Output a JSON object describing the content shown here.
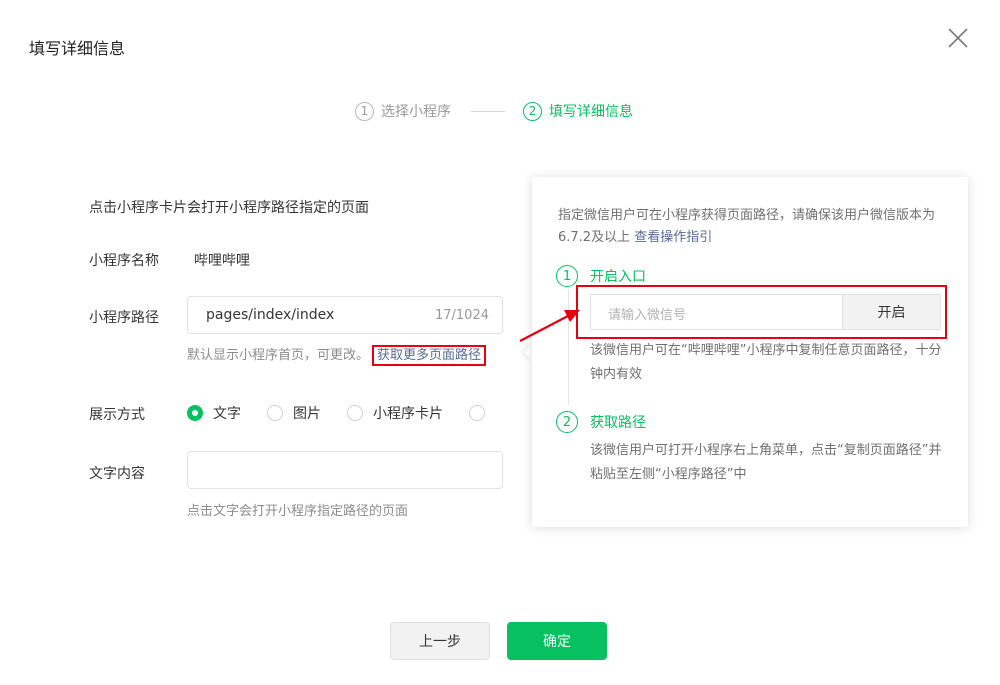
{
  "dialog": {
    "title": "填写详细信息"
  },
  "steps": [
    {
      "num": "1",
      "label": "选择小程序"
    },
    {
      "num": "2",
      "label": "填写详细信息"
    }
  ],
  "form": {
    "description": "点击小程序卡片会打开小程序路径指定的页面",
    "name_label": "小程序名称",
    "name_value": "哔哩哔哩",
    "path_label": "小程序路径",
    "path_value": "pages/index/index",
    "path_count": "17/1024",
    "path_hint": "默认显示小程序首页，可更改。",
    "path_hint_link": "获取更多页面路径",
    "display_label": "展示方式",
    "display_options": [
      "文字",
      "图片",
      "小程序卡片"
    ],
    "text_label": "文字内容",
    "text_value": "",
    "text_hint": "点击文字会打开小程序指定路径的页面"
  },
  "popover": {
    "intro": "指定微信用户可在小程序获得页面路径，请确保该用户微信版本为6.7.2及以上",
    "intro_link": "查看操作指引",
    "step1_num": "1",
    "step1_label": "开启入口",
    "wechat_placeholder": "请输入微信号",
    "open_button": "开启",
    "step1_note": "该微信用户可在“哔哩哔哩”小程序中复制任意页面路径，十分钟内有效",
    "step2_num": "2",
    "step2_label": "获取路径",
    "step2_note": "该微信用户可打开小程序右上角菜单，点击“复制页面路径”并粘贴至左侧“小程序路径”中"
  },
  "footer": {
    "prev_label": "上一步",
    "ok_label": "确定"
  },
  "colors": {
    "accent": "#07c160",
    "link": "#576b95",
    "annotation": "#e60012"
  }
}
